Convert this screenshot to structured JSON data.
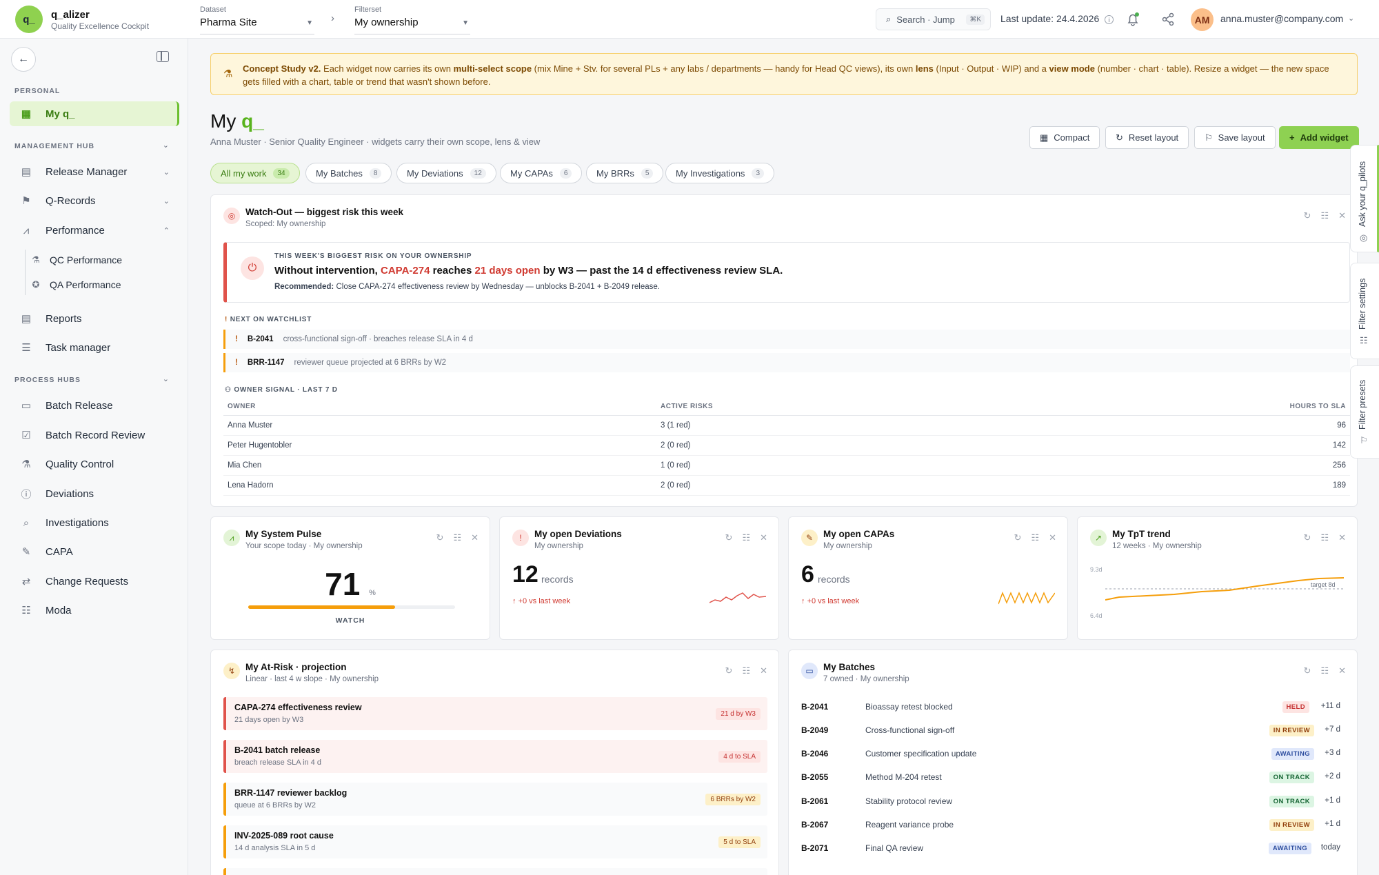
{
  "header": {
    "logo_text": "q_",
    "brand_name": "q_alizer",
    "brand_subtitle": "Quality Excellence Cockpit",
    "dataset_label": "Dataset",
    "dataset_value": "Pharma Site",
    "filterset_label": "Filterset",
    "filterset_value": "My ownership",
    "search_label": "Search · Jump",
    "search_shortcut": "⌘K",
    "last_update": "Last update: 24.4.2026",
    "avatar_initials": "AM",
    "user_email": "anna.muster@company.com"
  },
  "sidebar": {
    "personal_label": "PERSONAL",
    "my_q_label": "My q_",
    "management_label": "MANAGEMENT HUB",
    "management_items": [
      "Release Manager",
      "Q-Records",
      "Performance"
    ],
    "performance_sub": [
      "QC Performance",
      "QA Performance"
    ],
    "other_items": [
      "Reports",
      "Task manager"
    ],
    "process_label": "PROCESS HUBS",
    "process_items": [
      "Batch Release",
      "Batch Record Review",
      "Quality Control",
      "Deviations",
      "Investigations",
      "CAPA",
      "Change Requests",
      "Moda"
    ]
  },
  "banner": {
    "lead": "Concept Study v2.",
    "t1": " Each widget now carries its own ",
    "b1": "multi-select scope",
    "t2": " (mix Mine + Stv. for several PLs + any labs / departments — handy for Head QC views), its own ",
    "b2": "lens",
    "t3": " (Input · Output · WIP) and a ",
    "b3": "view mode",
    "t4": " (number · chart · table). Resize a widget — the new space gets filled with a chart, table or trend that wasn't shown before."
  },
  "page": {
    "title_prefix": "My",
    "title_accent": "q_",
    "subtitle": "Anna Muster · Senior Quality Engineer · widgets carry their own scope, lens & view",
    "btn_compact": "Compact",
    "btn_reset": "Reset layout",
    "btn_save": "Save layout",
    "btn_add": "Add widget"
  },
  "chips": [
    {
      "label": "All my work",
      "count": "34"
    },
    {
      "label": "My Batches",
      "count": "8"
    },
    {
      "label": "My Deviations",
      "count": "12"
    },
    {
      "label": "My CAPAs",
      "count": "6"
    },
    {
      "label": "My BRRs",
      "count": "5"
    },
    {
      "label": "My Investigations",
      "count": "3"
    }
  ],
  "watchout": {
    "title": "Watch-Out — biggest risk this week",
    "scope": "Scoped: My ownership",
    "kicker": "THIS WEEK'S BIGGEST RISK ON YOUR OWNERSHIP",
    "h1": "Without intervention, ",
    "h_capa": "CAPA-274",
    "h2": " reaches ",
    "h_days": "21 days open",
    "h3": " by W3 — past the 14 d effectiveness review SLA.",
    "rec_label": "Recommended:",
    "rec_text": " Close CAPA-274 effectiveness review by Wednesday — unblocks B-2041 + B-2049 release.",
    "watch_title": "NEXT ON WATCHLIST",
    "watchlist": [
      {
        "id": "B-2041",
        "text": "cross-functional sign-off · breaches release SLA in 4 d"
      },
      {
        "id": "BRR-1147",
        "text": "reviewer queue projected at 6 BRRs by W2"
      }
    ],
    "owner_title": "OWNER SIGNAL · LAST 7 D",
    "owner_headers": [
      "OWNER",
      "ACTIVE RISKS",
      "HOURS TO SLA"
    ],
    "owners": [
      {
        "name": "Anna Muster",
        "risks": "3 (1 red)",
        "hours": "96"
      },
      {
        "name": "Peter Hugentobler",
        "risks": "2 (0 red)",
        "hours": "142"
      },
      {
        "name": "Mia Chen",
        "risks": "1 (0 red)",
        "hours": "256"
      },
      {
        "name": "Lena Hadorn",
        "risks": "2 (0 red)",
        "hours": "189"
      }
    ]
  },
  "pulse": {
    "title": "My System Pulse",
    "sub": "Your scope today · My ownership",
    "value": "71",
    "unit": "%",
    "fill_percent": 71,
    "status": "WATCH"
  },
  "deviations": {
    "title": "My open Deviations",
    "sub": "My ownership",
    "value": "12",
    "unit": "records",
    "delta": "+0 vs last week"
  },
  "capas": {
    "title": "My open CAPAs",
    "sub": "My ownership",
    "value": "6",
    "unit": "records",
    "delta": "+0 vs last week"
  },
  "tpt": {
    "title": "My TpT trend",
    "sub": "12 weeks · My ownership",
    "ymax_label": "9.3d",
    "ymin_label": "6.4d",
    "target_label": "target 8d"
  },
  "atrisk": {
    "title": "My At-Risk · projection",
    "sub": "Linear · last 4 w slope · My ownership",
    "items": [
      {
        "title": "CAPA-274 effectiveness review",
        "sub": "21 days open by W3",
        "badge": "21 d by W3"
      },
      {
        "title": "B-2041 batch release",
        "sub": "breach release SLA in 4 d",
        "badge": "4 d to SLA"
      },
      {
        "title": "BRR-1147 reviewer backlog",
        "sub": "queue at 6 BRRs by W2",
        "badge": "6 BRRs by W2"
      },
      {
        "title": "INV-2025-089 root cause",
        "sub": "14 d analysis SLA in 5 d",
        "badge": "5 d to SLA"
      }
    ]
  },
  "batches": {
    "title": "My Batches",
    "sub": "7 owned · My ownership",
    "rows": [
      {
        "id": "B-2041",
        "desc": "Bioassay retest blocked",
        "status": "HELD",
        "due": "+11 d"
      },
      {
        "id": "B-2049",
        "desc": "Cross-functional sign-off",
        "status": "IN REVIEW",
        "due": "+7 d"
      },
      {
        "id": "B-2046",
        "desc": "Customer specification update",
        "status": "AWAITING",
        "due": "+3 d"
      },
      {
        "id": "B-2055",
        "desc": "Method M-204 retest",
        "status": "ON TRACK",
        "due": "+2 d"
      },
      {
        "id": "B-2061",
        "desc": "Stability protocol review",
        "status": "ON TRACK",
        "due": "+1 d"
      },
      {
        "id": "B-2067",
        "desc": "Reagent variance probe",
        "status": "IN REVIEW",
        "due": "+1 d"
      },
      {
        "id": "B-2071",
        "desc": "Final QA review",
        "status": "AWAITING",
        "due": "today"
      }
    ]
  },
  "right_tabs": [
    "Ask your q_pilots",
    "Filter settings",
    "Filter presets"
  ],
  "colors": {
    "accent": "#8ed152",
    "danger": "#d03a31",
    "warning": "#f59e0b"
  }
}
